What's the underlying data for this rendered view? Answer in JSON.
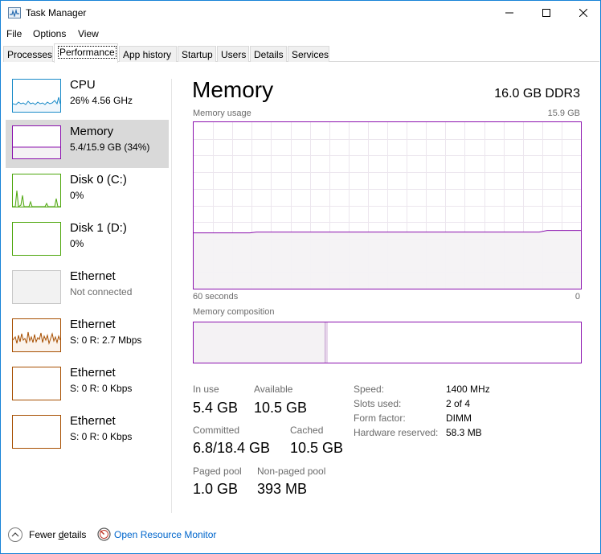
{
  "window": {
    "title": "Task Manager",
    "accent_color": "#1883d7"
  },
  "menu": [
    "File",
    "Options",
    "View"
  ],
  "tabs": [
    {
      "label": "Processes",
      "active": false
    },
    {
      "label": "Performance",
      "active": true
    },
    {
      "label": "App history",
      "active": false
    },
    {
      "label": "Startup",
      "active": false
    },
    {
      "label": "Users",
      "active": false
    },
    {
      "label": "Details",
      "active": false
    },
    {
      "label": "Services",
      "active": false
    }
  ],
  "sidebar": {
    "items": [
      {
        "title": "CPU",
        "subtitle": "26%  4.56 GHz",
        "color": "#1a8bc8",
        "selected": false
      },
      {
        "title": "Memory",
        "subtitle": "5.4/15.9 GB (34%)",
        "color": "#8b12ae",
        "selected": true
      },
      {
        "title": "Disk 0 (C:)",
        "subtitle": "0%",
        "color": "#4da60c",
        "selected": false
      },
      {
        "title": "Disk 1 (D:)",
        "subtitle": "0%",
        "color": "#4da60c",
        "selected": false
      },
      {
        "title": "Ethernet",
        "subtitle": "Not connected",
        "color": "#c8c8c8",
        "selected": false
      },
      {
        "title": "Ethernet",
        "subtitle": "S: 0  R: 2.7 Mbps",
        "color": "#a74f01",
        "selected": false
      },
      {
        "title": "Ethernet",
        "subtitle": "S: 0  R: 0 Kbps",
        "color": "#a74f01",
        "selected": false
      },
      {
        "title": "Ethernet",
        "subtitle": "S: 0  R: 0 Kbps",
        "color": "#a74f01",
        "selected": false
      }
    ]
  },
  "main": {
    "title": "Memory",
    "spec": "16.0 GB DDR3",
    "usage_label": "Memory usage",
    "usage_max": "15.9 GB",
    "graph_left": "60 seconds",
    "graph_right": "0",
    "composition_label": "Memory composition",
    "memory_color": "#8b12ae",
    "usage_fraction": 0.34,
    "composition_in_use_fraction": 0.34,
    "stats": {
      "in_use_label": "In use",
      "in_use": "5.4 GB",
      "available_label": "Available",
      "available": "10.5 GB",
      "committed_label": "Committed",
      "committed": "6.8/18.4 GB",
      "cached_label": "Cached",
      "cached": "10.5 GB",
      "paged_pool_label": "Paged pool",
      "paged_pool": "1.0 GB",
      "nonpaged_pool_label": "Non-paged pool",
      "nonpaged_pool": "393 MB"
    },
    "specs": [
      {
        "label": "Speed:",
        "value": "1400 MHz"
      },
      {
        "label": "Slots used:",
        "value": "2 of 4"
      },
      {
        "label": "Form factor:",
        "value": "DIMM"
      },
      {
        "label": "Hardware reserved:",
        "value": "58.3 MB"
      }
    ]
  },
  "footer": {
    "fewer_details_prefix": "Fewer ",
    "fewer_details_underlined": "d",
    "fewer_details_suffix": "etails",
    "resource_monitor": "Open Resource Monitor"
  }
}
